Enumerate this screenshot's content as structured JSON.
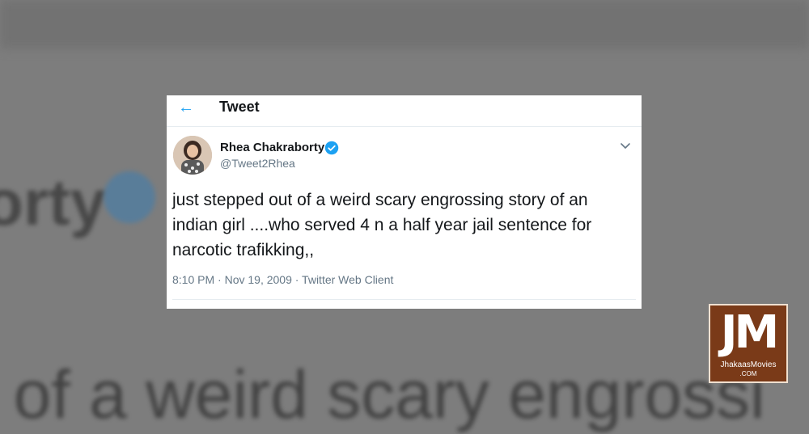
{
  "header": {
    "title": "Tweet"
  },
  "tweet": {
    "author_name": "Rhea Chakraborty",
    "handle": "@Tweet2Rhea",
    "text": "just stepped out of a weird scary engrossing story of an indian girl ....who served 4 n a half year jail sentence for narcotic trafikking,,",
    "timestamp": "8:10 PM · Nov 19, 2009 · Twitter Web Client",
    "verified_color": "#1da1f2"
  },
  "background": {
    "name_fragment": "orty",
    "text_fragment": "t of a weird scary engrossi"
  },
  "watermark": {
    "letters": "JM",
    "brand": "JhakaasMovies",
    "domain": ".COM"
  },
  "icons": {
    "back": "back-arrow-icon",
    "verified": "verified-badge-icon",
    "menu": "chevron-down-icon"
  }
}
